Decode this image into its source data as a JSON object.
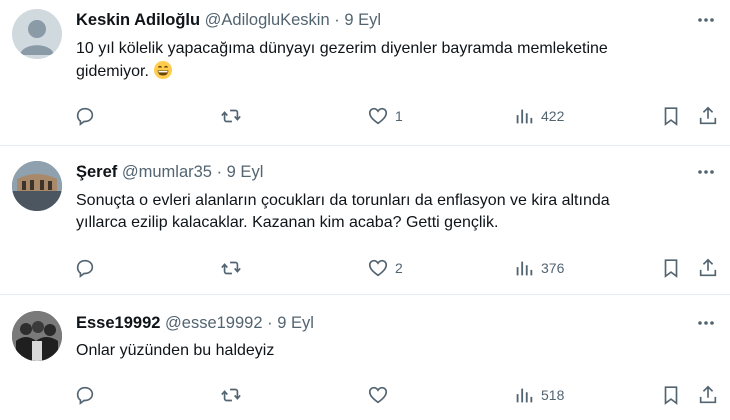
{
  "tweets": [
    {
      "name": "Keskin Adiloğlu",
      "handle": "@AdilogluKeskin",
      "date": "9 Eyl",
      "text_line1": "10 yıl kölelik yapacağıma dünyayı gezerim diyenler bayramda memleketine",
      "text_line2": "gidemiyor.",
      "emoji": "grinning-face-emoji",
      "replies": "",
      "retweets": "",
      "likes": "1",
      "views": "422"
    },
    {
      "name": "Şeref",
      "handle": "@mumlar35",
      "date": "9 Eyl",
      "text_line1": "Sonuçta o evleri alanların çocukları da  torunları da enflasyon ve kira altında",
      "text_line2": "yıllarca ezilip kalacaklar. Kazanan kim acaba? Getti gençlik.",
      "replies": "",
      "retweets": "",
      "likes": "2",
      "views": "376"
    },
    {
      "name": "Esse19992",
      "handle": "@esse19992",
      "date": "9 Eyl",
      "text_line1": "Onlar yüzünden bu haldeyiz",
      "replies": "",
      "retweets": "",
      "likes": "",
      "views": "518"
    }
  ],
  "separator": "·",
  "colors": {
    "text": "#0f1419",
    "muted": "#536471",
    "divider": "#e6ecf0"
  }
}
